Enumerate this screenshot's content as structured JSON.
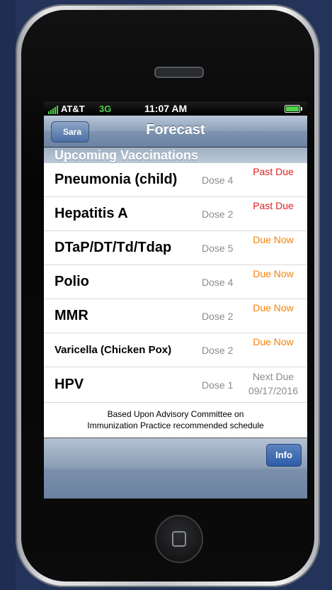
{
  "status_bar": {
    "carrier": "AT&T",
    "network": "3G",
    "time": "11:07 AM",
    "signal_icon": "signal-bars",
    "battery_icon": "battery-full"
  },
  "nav": {
    "back_label": "Sara",
    "title": "Forecast"
  },
  "section": {
    "header": "Upcoming Vaccinations"
  },
  "vaccinations": [
    {
      "name": "Pneumonia (child)",
      "dose": "Dose 4",
      "status_line1": "Past Due",
      "status_line2": "",
      "status_color": "#e02020"
    },
    {
      "name": "Hepatitis A",
      "dose": "Dose 2",
      "status_line1": "Past Due",
      "status_line2": "",
      "status_color": "#e02020"
    },
    {
      "name": "DTaP/DT/Td/Tdap",
      "dose": "Dose 5",
      "status_line1": "Due Now",
      "status_line2": "",
      "status_color": "#f5820b"
    },
    {
      "name": "Polio",
      "dose": "Dose 4",
      "status_line1": "Due Now",
      "status_line2": "",
      "status_color": "#f5820b"
    },
    {
      "name": "MMR",
      "dose": "Dose 2",
      "status_line1": "Due Now",
      "status_line2": "",
      "status_color": "#f5820b"
    },
    {
      "name": "Varicella (Chicken Pox)",
      "dose": "Dose 2",
      "status_line1": "Due Now",
      "status_line2": "",
      "status_color": "#f5820b"
    },
    {
      "name": "HPV",
      "dose": "Dose 1",
      "status_line1": "Next Due",
      "status_line2": "09/17/2016",
      "status_color": "#8b8b8b"
    }
  ],
  "footnote": {
    "line1": "Based Upon Advisory Committee on",
    "line2": "Immunization Practice recommended schedule"
  },
  "toolbar": {
    "info_label": "Info"
  },
  "colors": {
    "past_due": "#e02020",
    "due_now": "#f5820b",
    "next_due": "#8b8b8b",
    "signal": "#4fd24a"
  }
}
